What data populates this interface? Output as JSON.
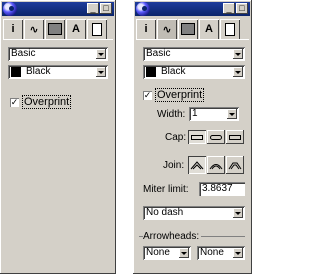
{
  "panels": {
    "left": {
      "preset": "Basic",
      "color": "Black",
      "overprint_label": "Overprint",
      "overprint_checked": true
    },
    "right": {
      "preset": "Basic",
      "color": "Black",
      "overprint_label": "Overprint",
      "overprint_checked": true,
      "width_label": "Width:",
      "width_value": "1",
      "cap_label": "Cap:",
      "join_label": "Join:",
      "miter_label": "Miter limit:",
      "miter_value": "3.8637",
      "dash_value": "No dash",
      "arrowheads_label": "Arrowheads:",
      "arrow_start": "None",
      "arrow_end": "None"
    }
  },
  "colors": {
    "panel_bg": "#d4d0c8",
    "titlebar": "#0a246a"
  },
  "icons": [
    "globe-icon",
    "info-icon",
    "stroke-icon",
    "fill-icon",
    "text-icon",
    "document-icon"
  ],
  "glyphs": {
    "check": "✓",
    "info": "i",
    "stroke": "∿",
    "text": "A",
    "doc": "▫",
    "min": "_",
    "max": "□"
  }
}
